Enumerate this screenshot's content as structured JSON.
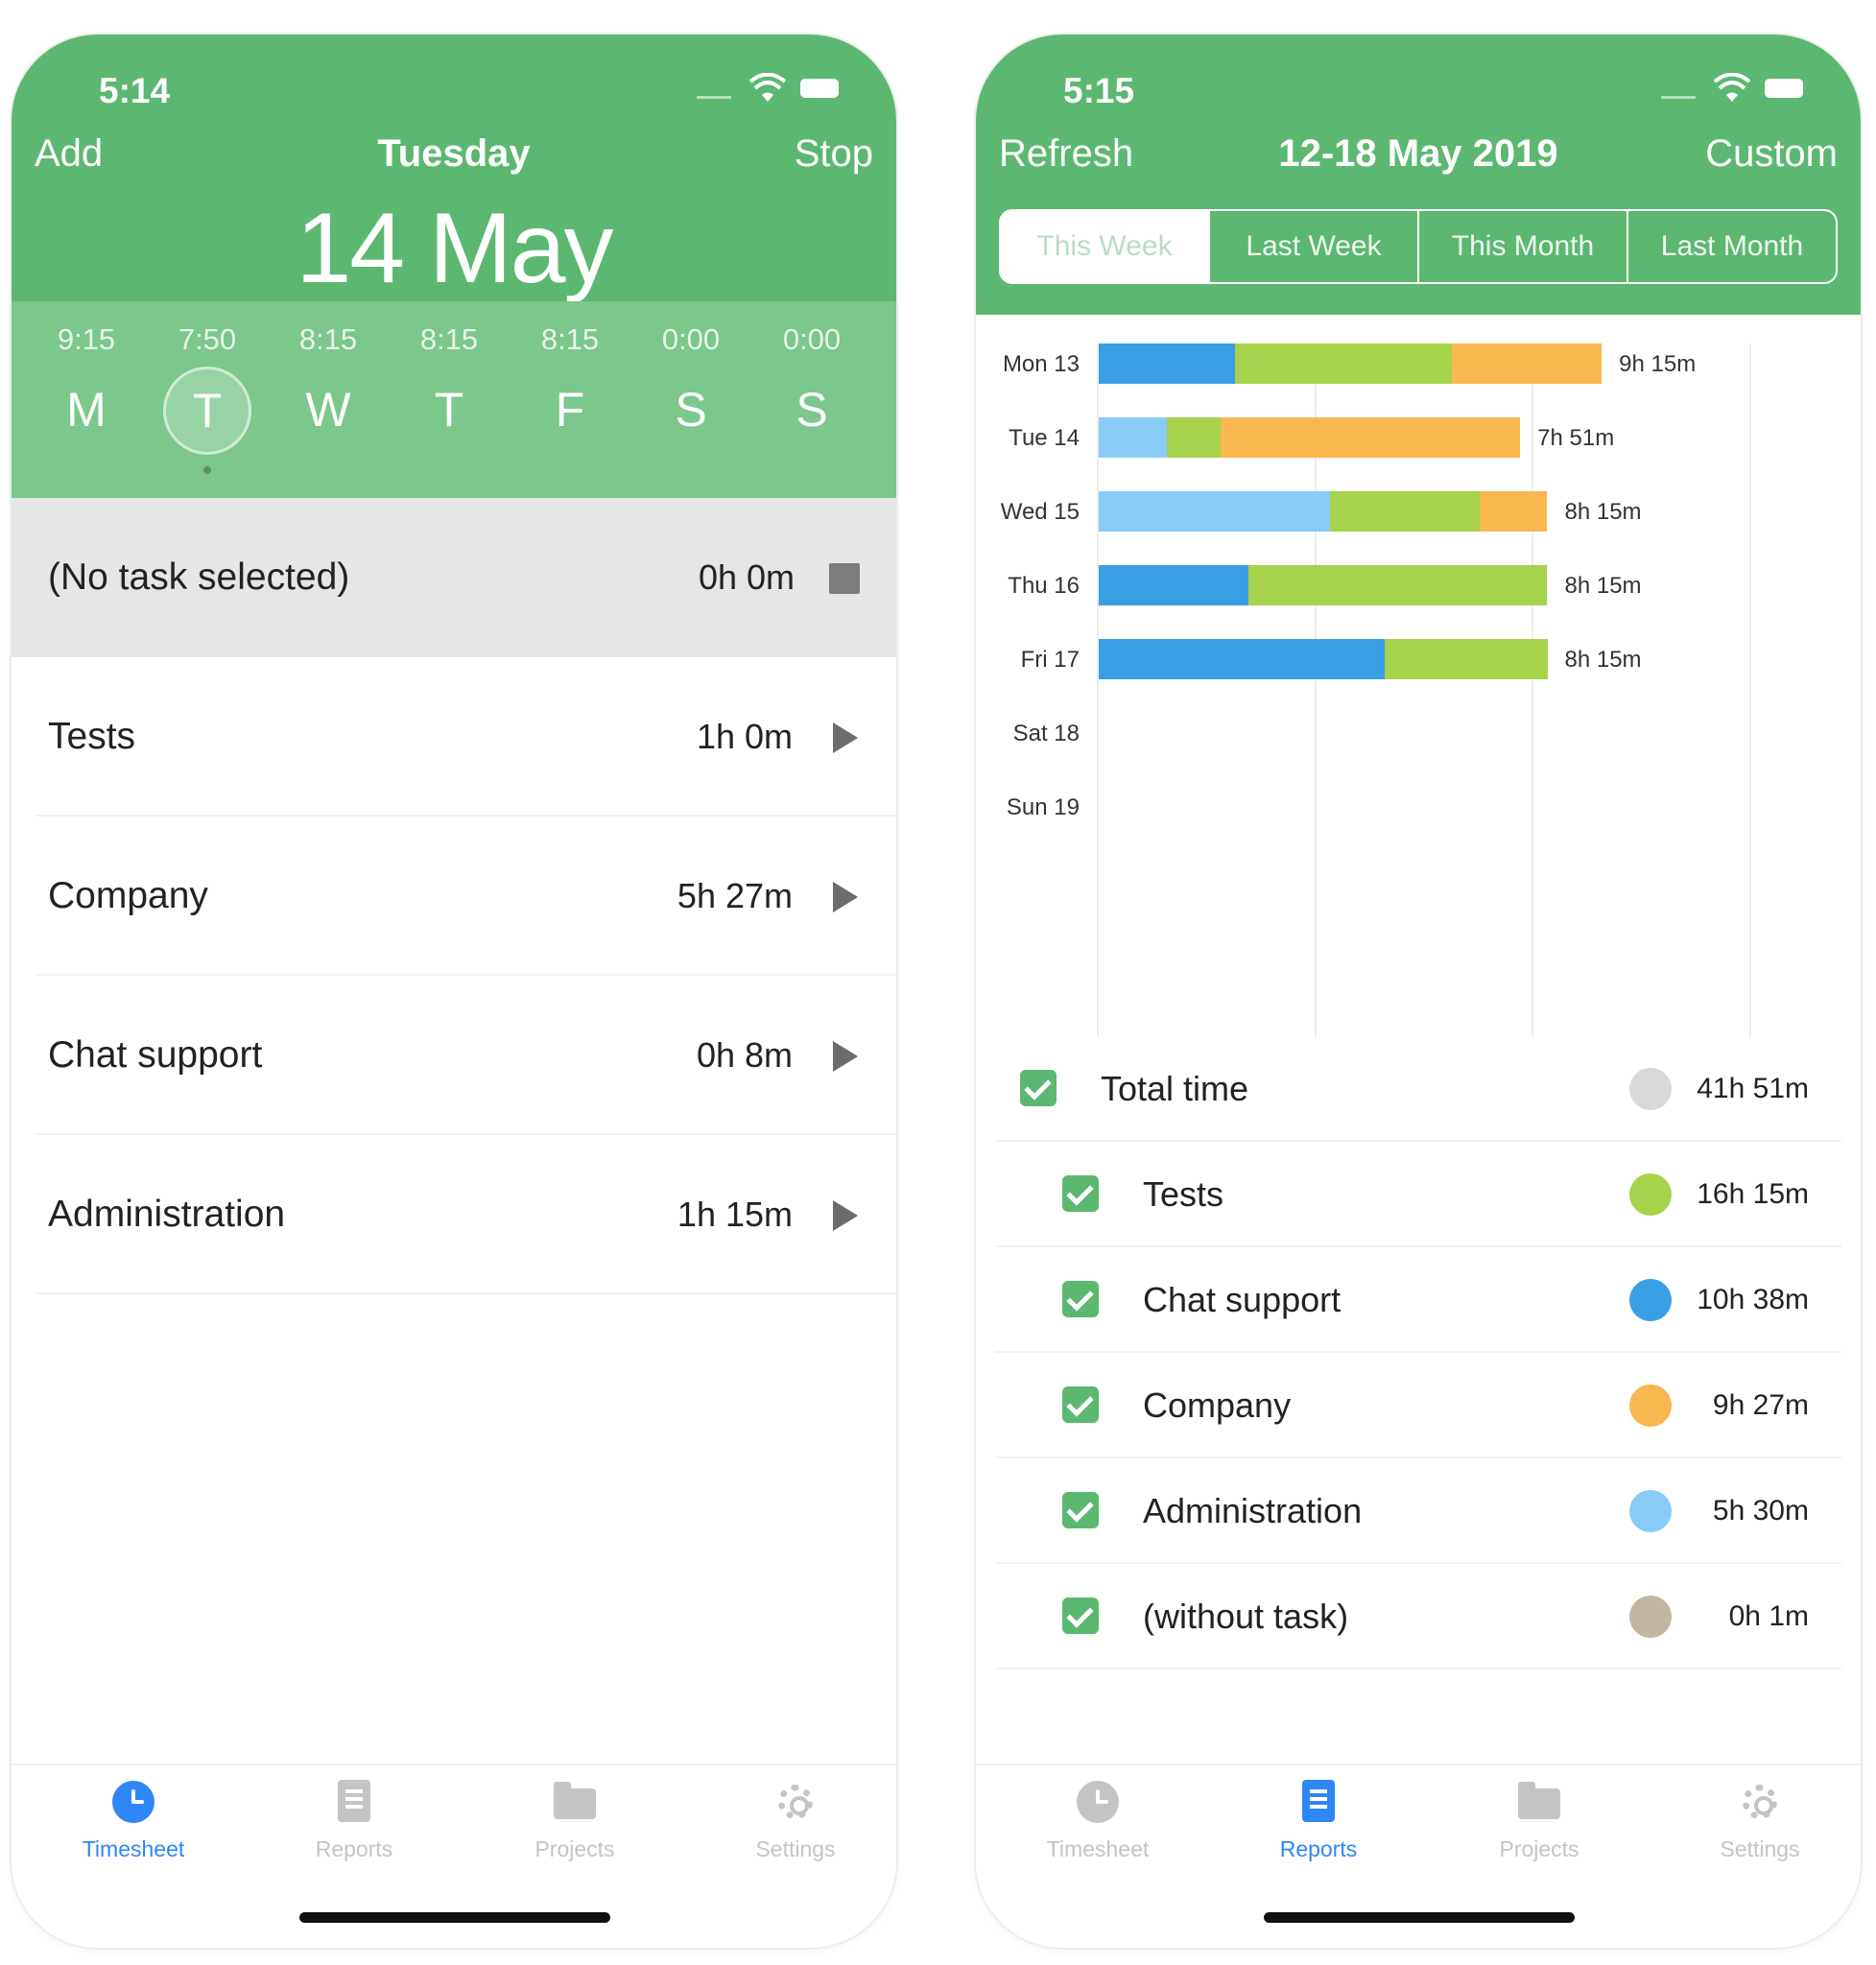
{
  "left": {
    "status_time": "5:14",
    "nav": {
      "left": "Add",
      "title": "Tuesday",
      "right": "Stop"
    },
    "big_date": "14 May",
    "week": [
      {
        "time": "9:15",
        "letter": "M"
      },
      {
        "time": "7:50",
        "letter": "T"
      },
      {
        "time": "8:15",
        "letter": "W"
      },
      {
        "time": "8:15",
        "letter": "T"
      },
      {
        "time": "8:15",
        "letter": "F"
      },
      {
        "time": "0:00",
        "letter": "S"
      },
      {
        "time": "0:00",
        "letter": "S"
      }
    ],
    "selected_day_index": 1,
    "current": {
      "name": "(No task selected)",
      "duration": "0h 0m"
    },
    "tasks": [
      {
        "name": "Tests",
        "duration": "1h 0m"
      },
      {
        "name": "Company",
        "duration": "5h 27m"
      },
      {
        "name": "Chat support",
        "duration": "0h 8m"
      },
      {
        "name": "Administration",
        "duration": "1h 15m"
      }
    ],
    "tabs": [
      "Timesheet",
      "Reports",
      "Projects",
      "Settings"
    ],
    "active_tab": "Timesheet"
  },
  "right": {
    "status_time": "5:15",
    "nav": {
      "left": "Refresh",
      "title": "12-18 May 2019",
      "right": "Custom"
    },
    "segments": [
      "This Week",
      "Last Week",
      "This Month",
      "Last Month"
    ],
    "selected_segment": "This Week",
    "legend": [
      {
        "name": "Total time",
        "value": "41h 51m",
        "color": "#d9d9d9",
        "checked": true
      },
      {
        "name": "Tests",
        "value": "16h 15m",
        "color": "#a6d24c",
        "checked": true
      },
      {
        "name": "Chat support",
        "value": "10h 38m",
        "color": "#3a9ee4",
        "checked": true
      },
      {
        "name": "Company",
        "value": "9h 27m",
        "color": "#f8b74f",
        "checked": true
      },
      {
        "name": "Administration",
        "value": "5h 30m",
        "color": "#89cbf7",
        "checked": true
      },
      {
        "name": "(without task)",
        "value": "0h 1m",
        "color": "#c2b6a3",
        "checked": true
      }
    ],
    "tabs": [
      "Timesheet",
      "Reports",
      "Projects",
      "Settings"
    ],
    "active_tab": "Reports"
  },
  "chart_data": {
    "type": "bar",
    "orientation": "horizontal",
    "stacked": true,
    "x_unit": "hours",
    "xlim": [
      0,
      12
    ],
    "categories": [
      "Mon 13",
      "Tue 14",
      "Wed 15",
      "Thu 16",
      "Fri 17",
      "Sat 18",
      "Sun 19"
    ],
    "total_labels": [
      "9h 15m",
      "7h 51m",
      "8h 15m",
      "8h 15m",
      "8h 15m",
      "",
      ""
    ],
    "series": [
      {
        "name": "Chat support",
        "color": "#3a9ee4",
        "values": [
          2.5,
          0,
          0,
          2.75,
          5.25,
          0,
          0
        ]
      },
      {
        "name": "Administration",
        "color": "#89cbf7",
        "values": [
          0,
          1.25,
          4.25,
          0,
          0,
          0,
          0
        ]
      },
      {
        "name": "Tests",
        "color": "#a6d24c",
        "values": [
          4.0,
          1.0,
          2.75,
          5.5,
          3.0,
          0,
          0
        ]
      },
      {
        "name": "Company",
        "color": "#f8b74f",
        "values": [
          2.75,
          5.5,
          1.25,
          0,
          0,
          0,
          0
        ]
      }
    ],
    "grid": true
  }
}
